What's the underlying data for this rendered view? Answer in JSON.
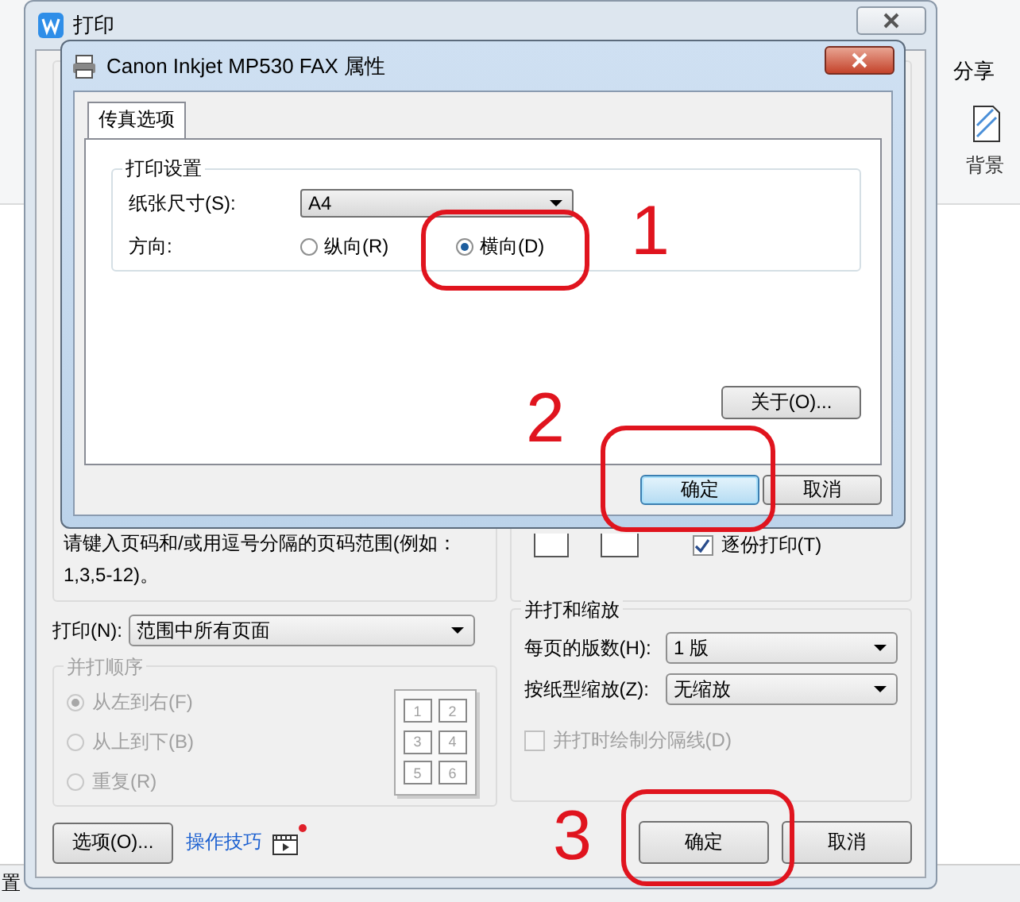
{
  "app": {
    "ribbon_items": [
      {
        "label": "分享"
      },
      {
        "label": "背景"
      }
    ],
    "status_text": "置"
  },
  "print_dialog": {
    "title": "打印",
    "range_hint": "请键入页码和/或用逗号分隔的页码范围(例如：1,3,5-12)。",
    "collate": {
      "label": "逐份打印(T)",
      "checked": true
    },
    "print_what": {
      "label": "打印(N):",
      "value": "范围中所有页面"
    },
    "order_group": {
      "title": "并打顺序",
      "disabled": true,
      "options": [
        {
          "label": "从左到右(F)",
          "selected": true
        },
        {
          "label": "从上到下(B)",
          "selected": false
        },
        {
          "label": "重复(R)",
          "selected": false
        }
      ],
      "preview_numbers": [
        "1",
        "2",
        "3",
        "4",
        "5",
        "6"
      ]
    },
    "zoom_group": {
      "title": "并打和缩放",
      "fields": [
        {
          "label": "每页的版数(H):",
          "value": "1 版"
        },
        {
          "label": "按纸型缩放(Z):",
          "value": "无缩放"
        }
      ],
      "separator": {
        "label": "并打时绘制分隔线(D)",
        "checked": false,
        "disabled": true
      }
    },
    "options_button": "选项(O)...",
    "tips_link": "操作技巧",
    "buttons": [
      {
        "label": "确定"
      },
      {
        "label": "取消"
      }
    ]
  },
  "fax_dialog": {
    "title": "Canon Inkjet MP530 FAX 属性",
    "tabs": [
      {
        "label": "传真选项",
        "selected": true
      }
    ],
    "group_title": "打印设置",
    "paper_size": {
      "label": "纸张尺寸(S):",
      "value": "A4"
    },
    "orientation": {
      "label": "方向:",
      "options": [
        {
          "label": "纵向(R)",
          "selected": false
        },
        {
          "label": "横向(D)",
          "selected": true
        }
      ]
    },
    "about_button": "关于(O)...",
    "buttons": [
      {
        "label": "确定",
        "default": true
      },
      {
        "label": "取消",
        "default": false
      }
    ]
  },
  "annotations": [
    {
      "label": "1"
    },
    {
      "label": "2"
    },
    {
      "label": "3"
    }
  ]
}
